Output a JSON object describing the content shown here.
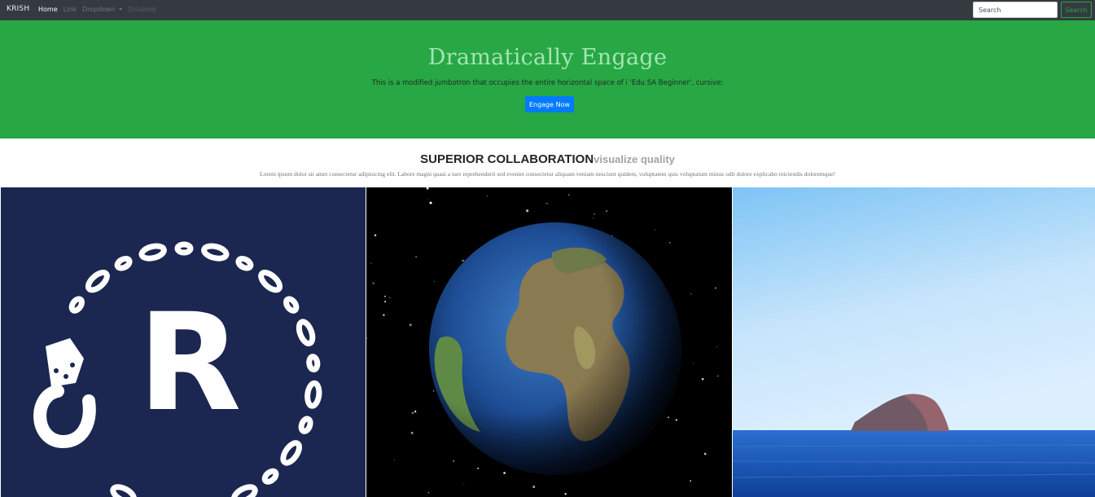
{
  "navbar": {
    "brand": "KRISH",
    "links": [
      {
        "label": "Home",
        "active": true
      },
      {
        "label": "Link"
      },
      {
        "label": "Dropdown"
      },
      {
        "label": "Disabled"
      }
    ],
    "search_placeholder": "Search",
    "search_button": "Search"
  },
  "jumbotron": {
    "title": "Dramatically Engage",
    "lead": "This is a modified jumbotron that occupies the entire horizontal space of i 'Edu SA Beginner', cursive;",
    "button": "Engage Now"
  },
  "section": {
    "heading": "SUPERIOR COLLABORATION",
    "heading_muted": "visualize quality",
    "text": "Lorem ipsum dolor sit amet consectetur adipisicing elit. Labore magni quasi a iure reprehenderit sed eveniet consectetur aliquam veniam nesciunt quidem, voluptatem quis voluptatum minus odit dolore explicabo reiciendis doloremque!"
  },
  "images": {
    "logo_letter": "R"
  },
  "colors": {
    "navbar_bg": "#343a40",
    "jumbotron_bg": "#28a745",
    "primary_button": "#007bff",
    "success_outline": "#28a745",
    "logo_bg": "#1b2750"
  }
}
